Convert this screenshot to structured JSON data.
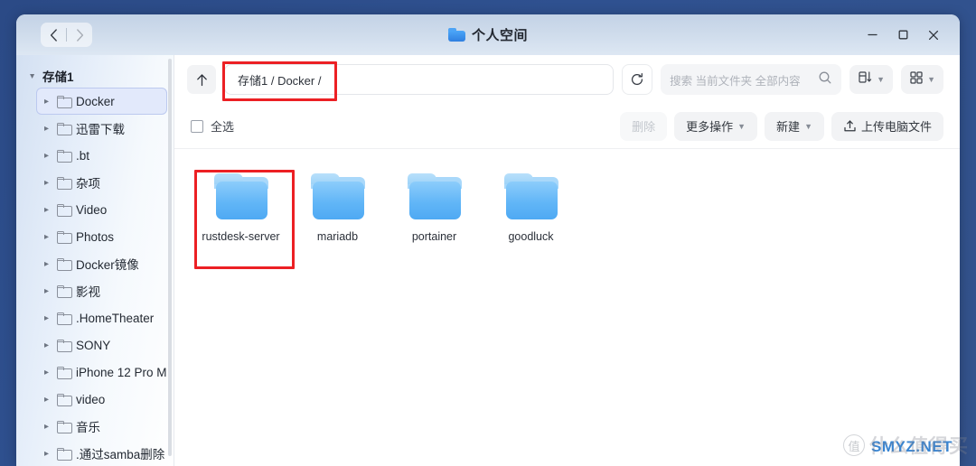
{
  "window": {
    "title": "个人空间",
    "title_icon": "folder-icon",
    "nav": {
      "back_icon": "chevron-left-icon",
      "forward_icon": "chevron-right-icon"
    },
    "controls": {
      "minimize": "minimize-icon",
      "maximize": "maximize-icon",
      "close": "close-icon"
    }
  },
  "sidebar": {
    "root_label": "存储1",
    "items": [
      {
        "label": "Docker",
        "selected": true
      },
      {
        "label": "迅雷下载",
        "selected": false
      },
      {
        "label": ".bt",
        "selected": false
      },
      {
        "label": "杂项",
        "selected": false
      },
      {
        "label": "Video",
        "selected": false
      },
      {
        "label": "Photos",
        "selected": false
      },
      {
        "label": "Docker镜像",
        "selected": false
      },
      {
        "label": "影视",
        "selected": false
      },
      {
        "label": ".HomeTheater",
        "selected": false
      },
      {
        "label": "SONY",
        "selected": false
      },
      {
        "label": "iPhone 12 Pro M",
        "selected": false
      },
      {
        "label": "video",
        "selected": false
      },
      {
        "label": "音乐",
        "selected": false
      },
      {
        "label": ".通过samba删除",
        "selected": false
      }
    ]
  },
  "toolbar": {
    "up_icon": "arrow-up-icon",
    "path_value": "存储1 / Docker /",
    "refresh_icon": "refresh-icon",
    "search": {
      "placeholder": "搜索 当前文件夹 全部内容",
      "icon": "search-icon"
    },
    "sort_button": {
      "icon": "sort-icon",
      "chevron": "chevron-down-icon"
    },
    "view_button": {
      "icon": "grid-view-icon",
      "chevron": "chevron-down-icon"
    }
  },
  "actionbar": {
    "select_all_label": "全选",
    "select_all_checked": false,
    "buttons": [
      {
        "label": "删除",
        "disabled": true,
        "icon": ""
      },
      {
        "label": "更多操作",
        "disabled": false,
        "icon": "chevron-down-icon"
      },
      {
        "label": "新建",
        "disabled": false,
        "icon": "chevron-down-icon"
      },
      {
        "label": "上传电脑文件",
        "disabled": false,
        "icon": "upload-icon"
      }
    ]
  },
  "files": [
    {
      "name": "rustdesk-server",
      "type": "folder",
      "highlighted": true
    },
    {
      "name": "mariadb",
      "type": "folder",
      "highlighted": false
    },
    {
      "name": "portainer",
      "type": "folder",
      "highlighted": false
    },
    {
      "name": "goodluck",
      "type": "folder",
      "highlighted": false
    }
  ],
  "annotations": {
    "color": "#EC2024",
    "boxes": [
      "path-bar",
      "rustdesk-server-item"
    ]
  },
  "watermark": {
    "badge": "值",
    "text": "什么值得买",
    "site": "SMYZ.NET"
  },
  "colors": {
    "desktop": "#2F5190",
    "accent": "#4EA9F3",
    "annotation": "#EC2024",
    "selected_item": "#E2E9FB"
  }
}
